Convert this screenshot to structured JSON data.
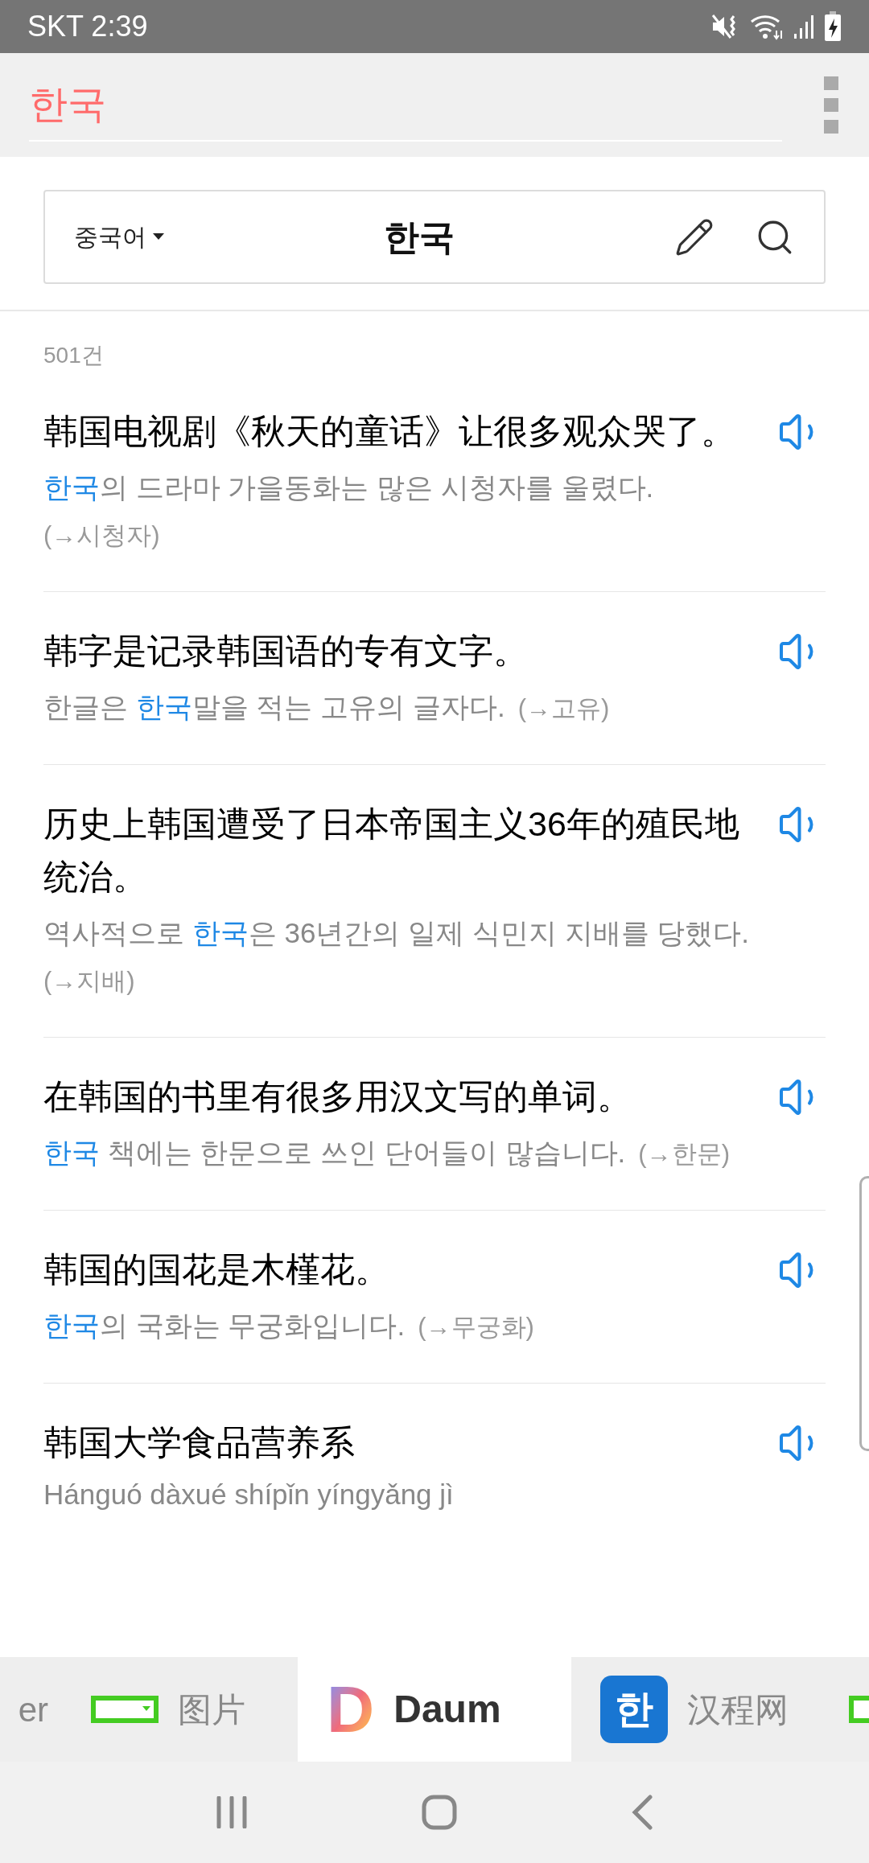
{
  "status_bar": {
    "carrier_time": "SKT 2:39"
  },
  "app_bar": {
    "query": "한국"
  },
  "search": {
    "language": "중국어",
    "value": "한국"
  },
  "result_count": "501건",
  "entries": [
    {
      "kind": "translation",
      "sentence": "韩国电视剧《秋天的童话》让很多观众哭了。",
      "segments": [
        {
          "text": "한국",
          "highlight": true
        },
        {
          "text": "의 드라마 가을동화는 많은 시청자를 울렸다.",
          "highlight": false
        }
      ],
      "ref": "(→시청자)",
      "ref_break": true
    },
    {
      "kind": "translation",
      "sentence": "韩字是记录韩国语的专有文字。",
      "segments": [
        {
          "text": "한글은 ",
          "highlight": false
        },
        {
          "text": "한국",
          "highlight": true
        },
        {
          "text": "말을 적는 고유의 글자다.",
          "highlight": false
        }
      ],
      "ref": "(→고유)",
      "ref_break": false
    },
    {
      "kind": "translation",
      "sentence": "历史上韩国遭受了日本帝国主义36年的殖民地统治。",
      "segments": [
        {
          "text": "역사적으로 ",
          "highlight": false
        },
        {
          "text": "한국",
          "highlight": true
        },
        {
          "text": "은 36년간의 일제 식민지 지배를 당했다.",
          "highlight": false
        }
      ],
      "ref": "(→지배)",
      "ref_break": true
    },
    {
      "kind": "translation",
      "sentence": "在韩国的书里有很多用汉文写的单词。",
      "segments": [
        {
          "text": "한국",
          "highlight": true
        },
        {
          "text": " 책에는 한문으로 쓰인 단어들이 많습니다.",
          "highlight": false
        }
      ],
      "ref": "(→한문)",
      "ref_break": false
    },
    {
      "kind": "translation",
      "sentence": "韩国的国花是木槿花。",
      "segments": [
        {
          "text": "한국",
          "highlight": true
        },
        {
          "text": "의 국화는 무궁화입니다.",
          "highlight": false
        }
      ],
      "ref": "(→무궁화)",
      "ref_break": false
    },
    {
      "kind": "pinyin",
      "sentence": "韩国大学食品营养系",
      "pinyin": "Hánguó dàxué shípǐn yíngyǎng jì"
    }
  ],
  "tabs": [
    {
      "kind": "plain",
      "label": "er",
      "selected": false
    },
    {
      "kind": "frame",
      "label": "图片",
      "selected": false
    },
    {
      "kind": "logo",
      "icon_label": "D",
      "label": "Daum",
      "selected": true
    },
    {
      "kind": "badge",
      "icon_label": "한",
      "label": "汉程网",
      "selected": false
    },
    {
      "kind": "frame",
      "selected": false
    }
  ]
}
